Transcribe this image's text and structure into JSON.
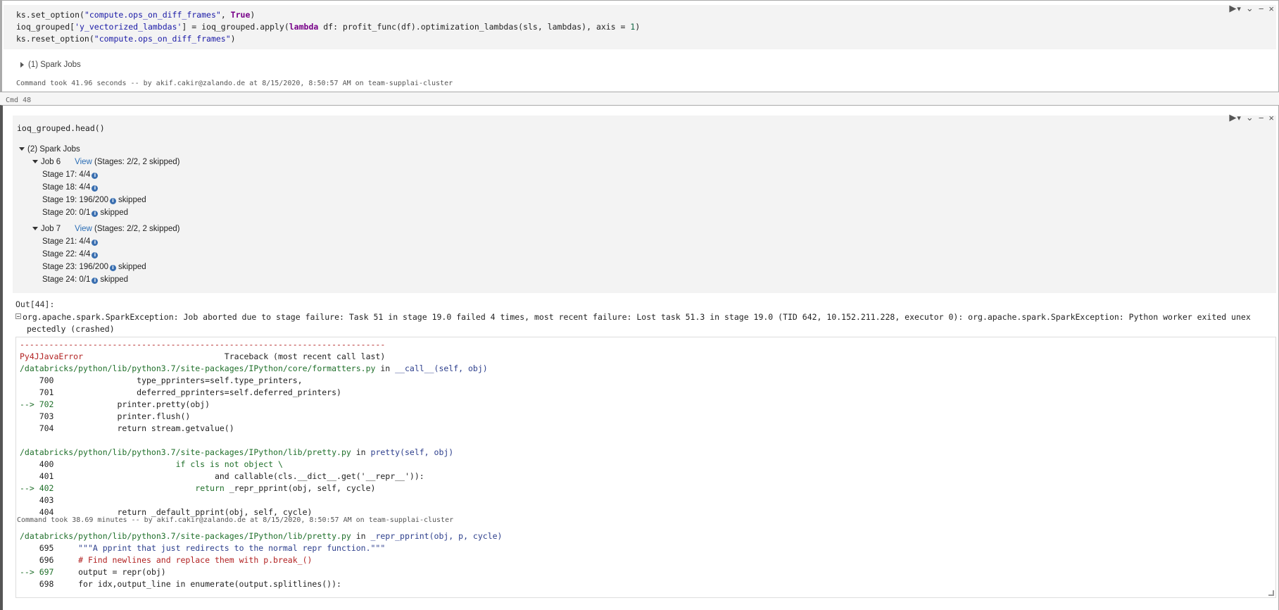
{
  "cell1": {
    "code_lines": [
      [
        {
          "t": "ks.set_option(",
          "c": ""
        },
        {
          "t": "\"compute.ops_on_diff_frames\"",
          "c": "str"
        },
        {
          "t": ", ",
          "c": ""
        },
        {
          "t": "True",
          "c": "kw"
        },
        {
          "t": ")",
          "c": ""
        }
      ],
      [
        {
          "t": "ioq_grouped[",
          "c": ""
        },
        {
          "t": "'y_vectorized_lambdas'",
          "c": "str"
        },
        {
          "t": "] = ioq_grouped.apply(",
          "c": ""
        },
        {
          "t": "lambda",
          "c": "kw"
        },
        {
          "t": " df: profit_func(df).optimization_lambdas(sls, lambdas), axis = ",
          "c": ""
        },
        {
          "t": "1",
          "c": "num"
        },
        {
          "t": ")",
          "c": ""
        }
      ],
      [
        {
          "t": "ks.reset_option(",
          "c": ""
        },
        {
          "t": "\"compute.ops_on_diff_frames\"",
          "c": "str"
        },
        {
          "t": ")",
          "c": ""
        }
      ]
    ],
    "spark_jobs_label": "(1) Spark Jobs",
    "command_took": "Command took 41.96 seconds -- by akif.cakir@zalando.de at 8/15/2020, 8:50:57 AM on team-supplai-cluster"
  },
  "cmd_label": "Cmd 48",
  "cell2": {
    "code": "ioq_grouped.head()",
    "spark_jobs_label": "(2) Spark Jobs",
    "jobs": [
      {
        "name": "Job 6",
        "view": "View",
        "stages_summary": "(Stages: 2/2, 2 skipped)",
        "stages": [
          {
            "label": "Stage 17: 4/4",
            "skipped": ""
          },
          {
            "label": "Stage 18: 4/4",
            "skipped": ""
          },
          {
            "label": "Stage 19: 196/200",
            "skipped": "skipped"
          },
          {
            "label": "Stage 20: 0/1",
            "skipped": "skipped"
          }
        ]
      },
      {
        "name": "Job 7",
        "view": "View",
        "stages_summary": "(Stages: 2/2, 2 skipped)",
        "stages": [
          {
            "label": "Stage 21: 4/4",
            "skipped": ""
          },
          {
            "label": "Stage 22: 4/4",
            "skipped": ""
          },
          {
            "label": "Stage 23: 196/200",
            "skipped": "skipped"
          },
          {
            "label": "Stage 24: 0/1",
            "skipped": "skipped"
          }
        ]
      }
    ],
    "out_label": "Out[44]:",
    "exception_line1": "org.apache.spark.SparkException: Job aborted due to stage failure: Task 51 in stage 19.0 failed 4 times, most recent failure: Lost task 51.3 in stage 19.0 (TID 642, 10.152.211.228, executor 0): org.apache.spark.SparkException: Python worker exited unex",
    "exception_line2": "pectedly (crashed)",
    "traceback": [
      [
        {
          "t": "---------------------------------------------------------------------------",
          "c": "tb-red"
        }
      ],
      [
        {
          "t": "Py4JJavaError",
          "c": "tb-red"
        },
        {
          "t": "                             Traceback (most recent call last)",
          "c": ""
        }
      ],
      [
        {
          "t": "/databricks/python/lib/python3.7/site-packages/IPython/core/formatters.py",
          "c": "tb-green"
        },
        {
          "t": " in ",
          "c": ""
        },
        {
          "t": "__call__",
          "c": "tb-blue"
        },
        {
          "t": "(self, obj)",
          "c": "tb-blue"
        }
      ],
      [
        {
          "t": "    700                 type_pprinters=self.type_printers,",
          "c": ""
        }
      ],
      [
        {
          "t": "    701                 deferred_pprinters=self.deferred_printers)",
          "c": ""
        }
      ],
      [
        {
          "t": "--> 702",
          "c": "tb-green"
        },
        {
          "t": "             printer.pretty(obj)",
          "c": ""
        }
      ],
      [
        {
          "t": "    703             printer.flush()",
          "c": ""
        }
      ],
      [
        {
          "t": "    704             return stream.getvalue()",
          "c": ""
        }
      ],
      [
        {
          "t": "",
          "c": ""
        }
      ],
      [
        {
          "t": "/databricks/python/lib/python3.7/site-packages/IPython/lib/pretty.py",
          "c": "tb-green"
        },
        {
          "t": " in ",
          "c": ""
        },
        {
          "t": "pretty",
          "c": "tb-blue"
        },
        {
          "t": "(self, obj)",
          "c": "tb-blue"
        }
      ],
      [
        {
          "t": "    400                         ",
          "c": ""
        },
        {
          "t": "if cls is not object \\",
          "c": "tb-kw"
        }
      ],
      [
        {
          "t": "    401                                 ",
          "c": ""
        },
        {
          "t": "and callable(cls.__dict__.get('__repr__')):",
          "c": ""
        }
      ],
      [
        {
          "t": "--> 402",
          "c": "tb-green"
        },
        {
          "t": "                             ",
          "c": ""
        },
        {
          "t": "return",
          "c": "tb-kw"
        },
        {
          "t": " _repr_pprint(obj, self, cycle)",
          "c": ""
        }
      ],
      [
        {
          "t": "    403",
          "c": ""
        }
      ],
      [
        {
          "t": "    404             return _default_pprint(obj, self, cycle)",
          "c": ""
        }
      ],
      [
        {
          "t": "",
          "c": ""
        }
      ],
      [
        {
          "t": "/databricks/python/lib/python3.7/site-packages/IPython/lib/pretty.py",
          "c": "tb-green"
        },
        {
          "t": " in ",
          "c": ""
        },
        {
          "t": "_repr_pprint",
          "c": "tb-blue"
        },
        {
          "t": "(obj, p, cycle)",
          "c": "tb-blue"
        }
      ],
      [
        {
          "t": "    695     ",
          "c": ""
        },
        {
          "t": "\"\"\"A pprint that just redirects to the normal repr function.\"\"\"",
          "c": "tb-blue"
        }
      ],
      [
        {
          "t": "    696     ",
          "c": ""
        },
        {
          "t": "# Find newlines and replace them with p.break_()",
          "c": "tb-red"
        }
      ],
      [
        {
          "t": "--> 697",
          "c": "tb-green"
        },
        {
          "t": "     output = repr(obj)",
          "c": ""
        }
      ],
      [
        {
          "t": "    698     for idx,output_line in enumerate(output.splitlines()):",
          "c": ""
        }
      ]
    ],
    "command_took": "Command took 38.69 minutes -- by akif.cakir@zalando.de at 8/15/2020, 8:50:57 AM on team-supplai-cluster"
  },
  "toolbar": {
    "run_icon": "▶",
    "chevron_icon": "▾",
    "collapse_icon": "⌄",
    "minimize_icon": "−",
    "close_icon": "×"
  },
  "info_icon_glyph": "i"
}
